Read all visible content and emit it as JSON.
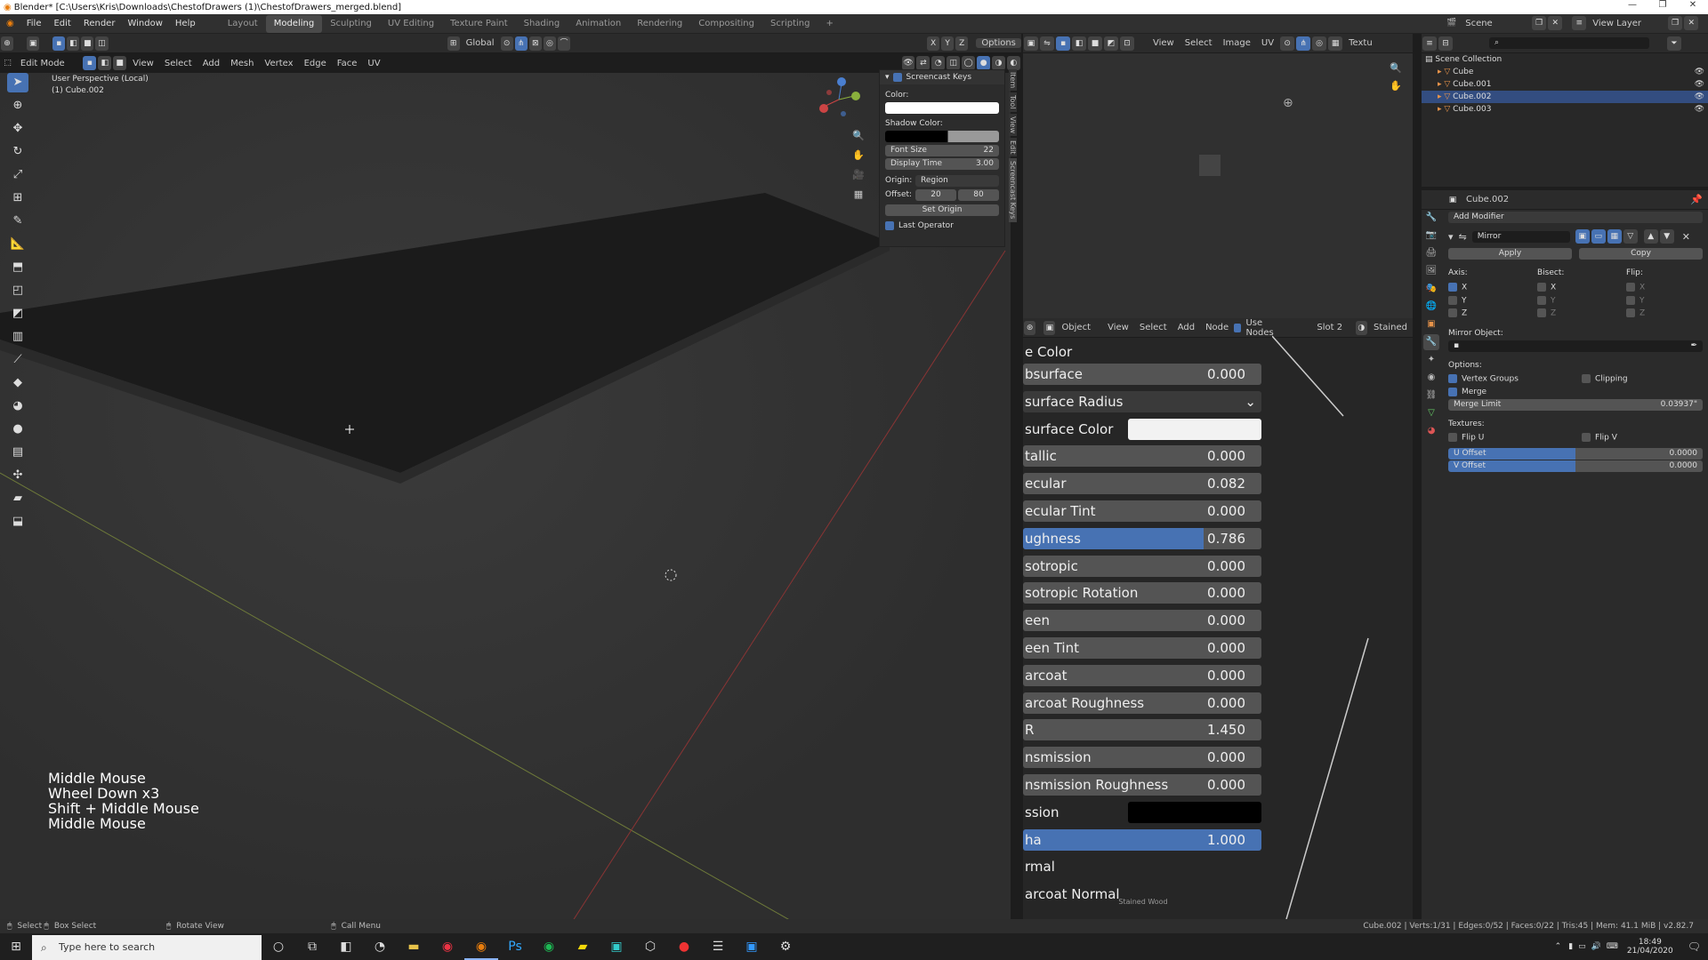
{
  "title": "Blender* [C:\\Users\\Kris\\Downloads\\ChestofDrawers (1)\\ChestofDrawers_merged.blend]",
  "menu": [
    "File",
    "Edit",
    "Render",
    "Window",
    "Help"
  ],
  "workspaces": [
    "Layout",
    "Modeling",
    "Sculpting",
    "UV Editing",
    "Texture Paint",
    "Shading",
    "Animation",
    "Rendering",
    "Compositing",
    "Scripting"
  ],
  "active_workspace": "Modeling",
  "scene": {
    "scene_label": "Scene",
    "view_layer": "View Layer"
  },
  "viewport": {
    "mode": "Edit Mode",
    "menus": [
      "View",
      "Select",
      "Add",
      "Mesh",
      "Vertex",
      "Edge",
      "Face",
      "UV"
    ],
    "transform": "Global",
    "options": "Options",
    "overlay_title": "User Perspective (Local)",
    "overlay_object": "(1) Cube.002",
    "keys": [
      "Middle Mouse",
      "Wheel Down x3",
      "Shift + Middle Mouse",
      "Middle Mouse"
    ],
    "axes": {
      "x": "X",
      "y": "Y",
      "z": "Z"
    }
  },
  "screencast": {
    "title": "Screencast Keys",
    "color_label": "Color:",
    "shadow_label": "Shadow Color:",
    "font_size_label": "Font Size",
    "font_size": "22",
    "display_time_label": "Display Time",
    "display_time": "3.00",
    "origin_label": "Origin:",
    "origin_value": "Region",
    "offset_label": "Offset:",
    "offset_x": "20",
    "offset_y": "80",
    "set_origin": "Set Origin",
    "last_operator": "Last Operator",
    "tabs": [
      "Item",
      "Tool",
      "View",
      "Edit",
      "Screencast Keys"
    ]
  },
  "image_editor": {
    "menus": [
      "View",
      "Select",
      "Image",
      "UV"
    ],
    "extra": "Textu"
  },
  "node_header": {
    "mode": "Object",
    "menus": [
      "View",
      "Select",
      "Add",
      "Node"
    ],
    "use_nodes": "Use Nodes",
    "slot": "Slot 2",
    "material": "Stained"
  },
  "material_props": [
    {
      "label": "e Color",
      "value": "",
      "style": "label"
    },
    {
      "label": "bsurface",
      "value": "0.000",
      "style": "field"
    },
    {
      "label": "surface Radius",
      "value": "",
      "style": "dropdown"
    },
    {
      "label": "surface Color",
      "value": "",
      "style": "color-white"
    },
    {
      "label": "tallic",
      "value": "0.000",
      "style": "field"
    },
    {
      "label": "ecular",
      "value": "0.082",
      "style": "field"
    },
    {
      "label": "ecular Tint",
      "value": "0.000",
      "style": "field"
    },
    {
      "label": "ughness",
      "value": "0.786",
      "style": "half"
    },
    {
      "label": "sotropic",
      "value": "0.000",
      "style": "field"
    },
    {
      "label": "sotropic Rotation",
      "value": "0.000",
      "style": "field"
    },
    {
      "label": "een",
      "value": "0.000",
      "style": "field"
    },
    {
      "label": "een Tint",
      "value": "0.000",
      "style": "field"
    },
    {
      "label": "arcoat",
      "value": "0.000",
      "style": "field"
    },
    {
      "label": "arcoat Roughness",
      "value": "0.000",
      "style": "field"
    },
    {
      "label": "R",
      "value": "1.450",
      "style": "field"
    },
    {
      "label": "nsmission",
      "value": "0.000",
      "style": "field"
    },
    {
      "label": "nsmission Roughness",
      "value": "0.000",
      "style": "field"
    },
    {
      "label": "ssion",
      "value": "",
      "style": "color-black"
    },
    {
      "label": "ha",
      "value": "1.000",
      "style": "selected"
    },
    {
      "label": "rmal",
      "value": "",
      "style": "label"
    },
    {
      "label": "arcoat Normal",
      "value": "",
      "style": "label"
    }
  ],
  "outliner": {
    "collection": "Scene Collection",
    "items": [
      "Cube",
      "Cube.001",
      "Cube.002",
      "Cube.003"
    ],
    "selected": "Cube.002"
  },
  "properties": {
    "object": "Cube.002",
    "add_modifier": "Add Modifier",
    "modifier_name": "Mirror",
    "apply": "Apply",
    "copy": "Copy",
    "axis_label": "Axis:",
    "bisect_label": "Bisect:",
    "flip_label": "Flip:",
    "axes": [
      "X",
      "Y",
      "Z"
    ],
    "mirror_object": "Mirror Object:",
    "options_label": "Options:",
    "vertex_groups": "Vertex Groups",
    "clipping": "Clipping",
    "merge": "Merge",
    "merge_limit_label": "Merge Limit",
    "merge_limit": "0.03937\"",
    "textures_label": "Textures:",
    "flip_u": "Flip U",
    "flip_v": "Flip V",
    "u_offset_label": "U Offset",
    "u_offset": "0.0000",
    "v_offset_label": "V Offset",
    "v_offset": "0.0000"
  },
  "statusbar": {
    "select": "Select",
    "box_select": "Box Select",
    "rotate_view": "Rotate View",
    "call_menu": "Call Menu",
    "stats": "Cube.002 | Verts:1/31 | Edges:0/52 | Faces:0/22 | Tris:45 | Mem: 41.1 MiB | v2.82.7"
  },
  "taskbar": {
    "search_placeholder": "Type here to search",
    "time": "18:49",
    "date": "21/04/2020"
  },
  "colors": {
    "accent": "#4772b3",
    "selected_row": "#334d80"
  }
}
